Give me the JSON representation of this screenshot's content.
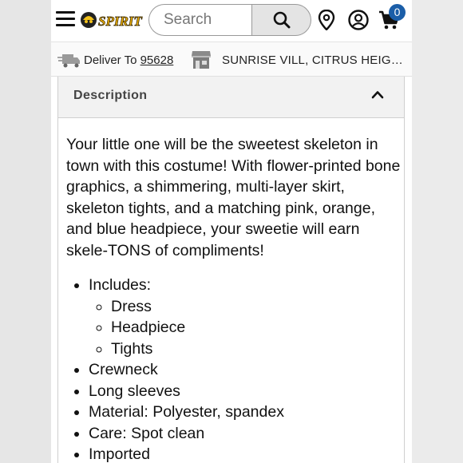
{
  "header": {
    "logo_text": "SPIRIT",
    "search": {
      "placeholder": "Search",
      "value": ""
    },
    "cart_count": "0",
    "icons": [
      "menu-icon",
      "search-icon",
      "location-pin-icon",
      "account-icon",
      "cart-icon"
    ]
  },
  "delivery": {
    "label": "Deliver To",
    "zip": "95628",
    "store": "SUNRISE VILL, CITRUS HEIGHTS, CA",
    "icons": [
      "delivery-truck-icon",
      "store-icon"
    ]
  },
  "accordion": {
    "title": "Description",
    "expanded": true,
    "description": "Your little one will be the sweetest skeleton in town with this costume! With flower-printed bone graphics, a shimmering, multi-layer skirt, skeleton tights, and a matching pink, orange, and blue headpiece, your sweetie will earn skele-TONS of compliments!",
    "features": {
      "includes_label": "Includes:",
      "includes": [
        "Dress",
        "Headpiece",
        "Tights"
      ],
      "items": [
        "Crewneck",
        "Long sleeves",
        "Material: Polyester, spandex",
        "Care: Spot clean",
        "Imported"
      ]
    }
  },
  "colors": {
    "cart_badge": "#1b5ea8",
    "accordion_header": "#f2f2f2",
    "text": "#111111"
  }
}
